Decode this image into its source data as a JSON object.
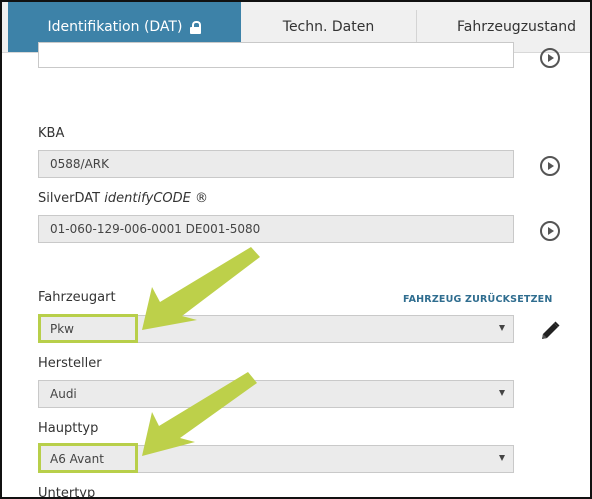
{
  "tabs": [
    {
      "label": "Identifikation (DAT)",
      "active": true,
      "locked": true
    },
    {
      "label": "Techn. Daten",
      "active": false
    },
    {
      "label": "Fahrzeugzustand",
      "active": false
    }
  ],
  "form": {
    "kba": {
      "label": "KBA",
      "value": "0588/ARK"
    },
    "silverdat": {
      "label_prefix": "SilverDAT ",
      "label_italic": "identifyCODE",
      "label_suffix": " ®",
      "value": "01-060-129-006-0001 DE001-5080"
    },
    "fahrzeugart": {
      "label": "Fahrzeugart",
      "value": "Pkw"
    },
    "reset_link": "FAHRZEUG ZURÜCKSETZEN",
    "hersteller": {
      "label": "Hersteller",
      "value": "Audi"
    },
    "haupttyp": {
      "label": "Haupttyp",
      "value": "A6 Avant"
    },
    "untertyp": {
      "label": "Untertyp"
    }
  },
  "colors": {
    "active_tab": "#3d82a8",
    "highlight": "#b8cf4a",
    "field_bg": "#ebebeb",
    "link": "#2f6d8f"
  },
  "icons": [
    "lock-icon",
    "play-circle-icon",
    "pencil-icon",
    "caret-down-icon"
  ]
}
